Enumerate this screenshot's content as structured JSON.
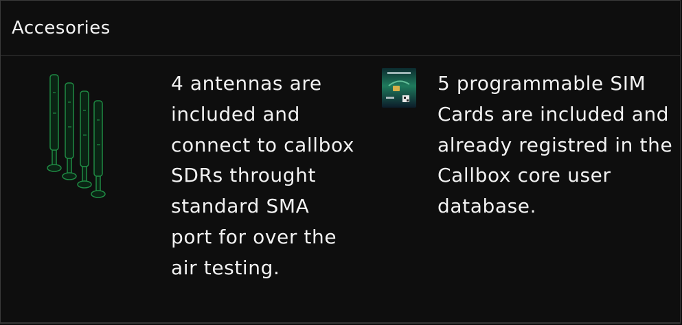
{
  "panel": {
    "title": "Accesories"
  },
  "items": [
    {
      "image": "antenna-set-icon",
      "description": "4 antennas are included and connect to callbox SDRs throught standard SMA port for over the air testing."
    },
    {
      "image": "sim-card-icon",
      "description": "5 programmable SIM Cards are included and already registred in the Callbox core user database."
    }
  ],
  "colors": {
    "background": "#0e0e0e",
    "border": "#333333",
    "text": "#f2f2f2",
    "antenna_green": "#1f8a43"
  }
}
